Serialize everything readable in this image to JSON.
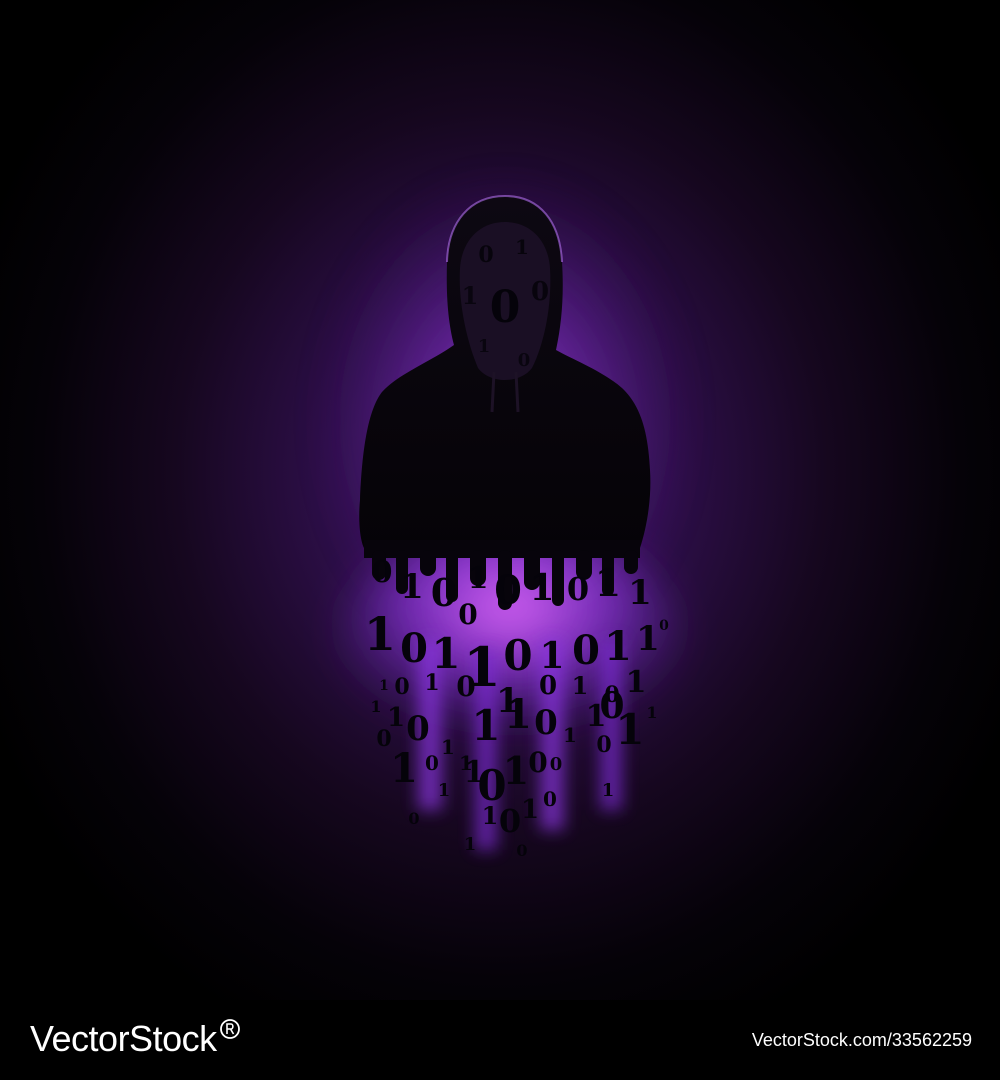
{
  "illustration": {
    "subject": "hooded-hacker-silhouette",
    "glow_color": "#a54bff",
    "background_color": "#000000",
    "face_digits": [
      "0",
      "1",
      "0",
      "1",
      "0",
      "1",
      "0"
    ],
    "falling_digits": [
      "0",
      "1",
      "0",
      "1",
      "0",
      "1",
      "0",
      "1",
      "1",
      "0",
      "1",
      "0",
      "1",
      "1",
      "0",
      "1",
      "0",
      "1",
      "1",
      "0",
      "1",
      "0",
      "1",
      "0",
      "1",
      "0",
      "1",
      "1",
      "0",
      "1",
      "1",
      "0",
      "1",
      "0",
      "1",
      "0",
      "1",
      "1",
      "0",
      "1",
      "0",
      "1",
      "0",
      "1",
      "0",
      "1",
      "0",
      "1",
      "0",
      "1",
      "1",
      "0",
      "1",
      "0",
      "1",
      "0",
      "1",
      "0",
      "1",
      "1"
    ]
  },
  "footer": {
    "brand": "VectorStock",
    "brand_mark": "registered-mark",
    "image_id": "VectorStock.com/33562259"
  }
}
